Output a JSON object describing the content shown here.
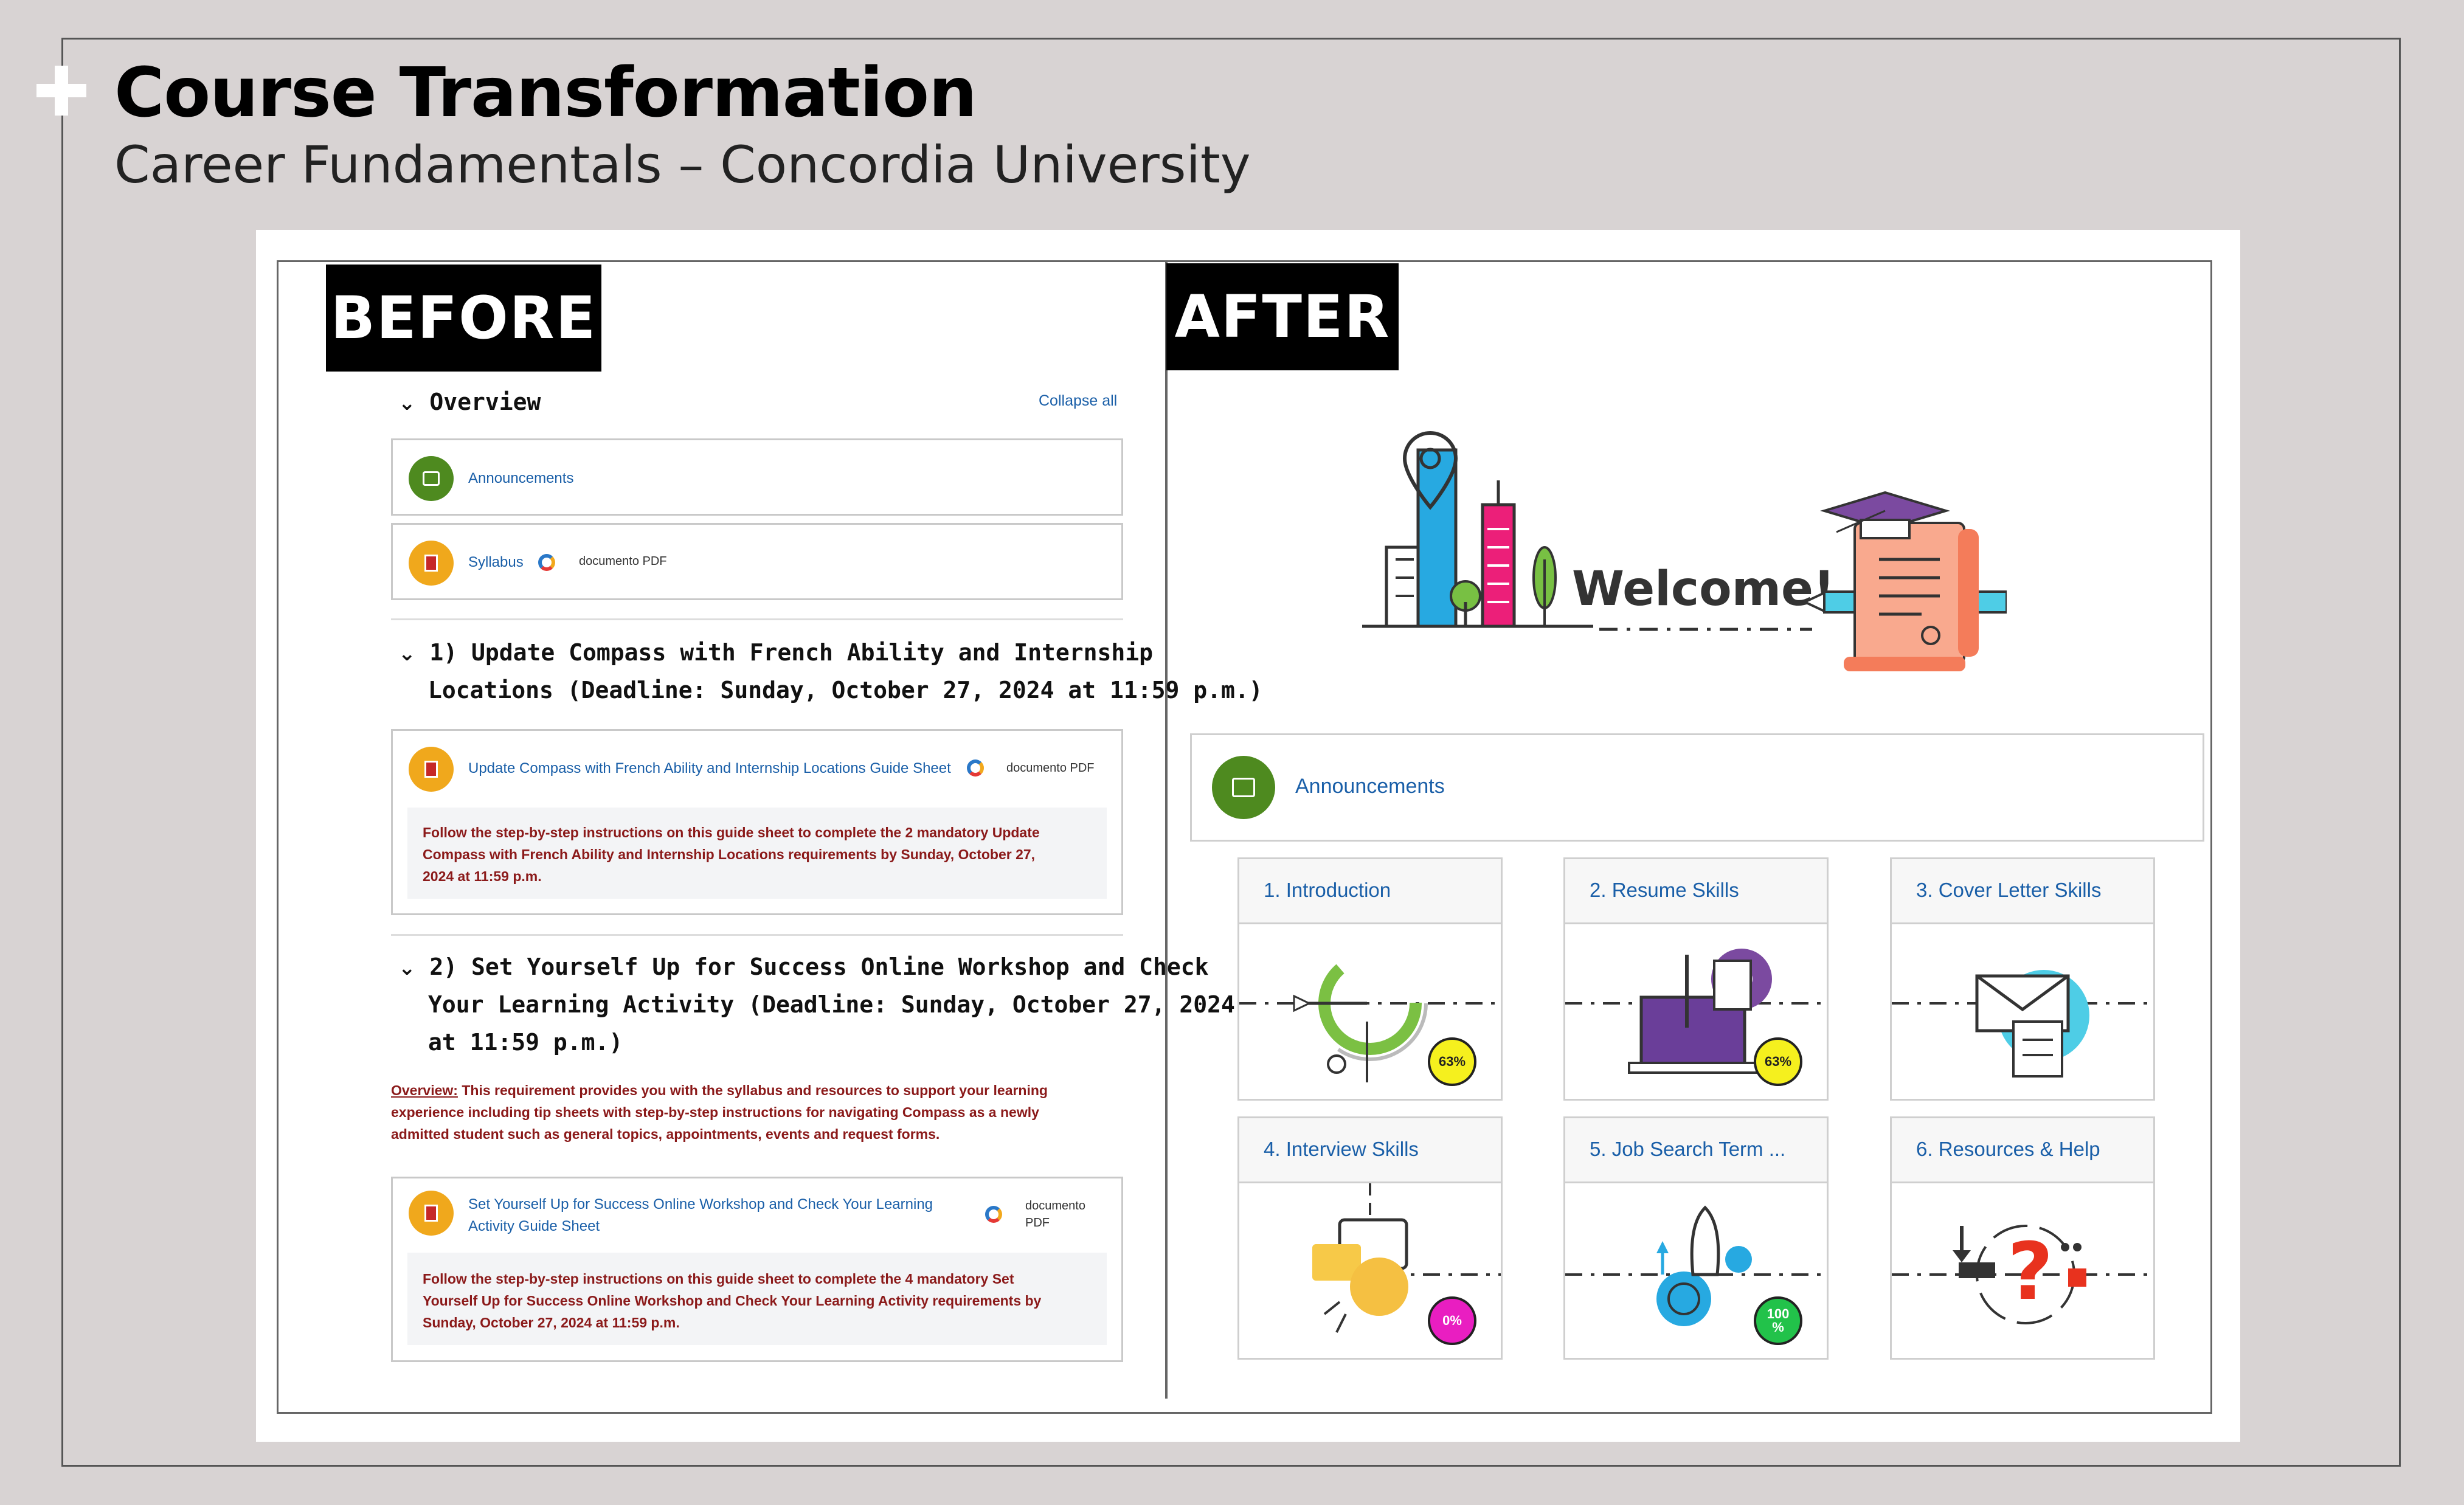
{
  "slide": {
    "title": "Course Transformation",
    "subtitle": "Career Fundamentals – Concordia University"
  },
  "tags": {
    "before": "BEFORE",
    "after": "AFTER"
  },
  "before": {
    "overview_heading": "Overview",
    "collapse_all": "Collapse all",
    "announcements": "Announcements",
    "syllabus": "Syllabus",
    "pdf_label": "documento PDF",
    "section1_line1": "1) Update Compass with French Ability and Internship",
    "section1_line2": "Locations (Deadline: Sunday, October 27, 2024 at 11:59 p.m.)",
    "guide1_link": "Update Compass with French Ability and Internship Locations Guide Sheet",
    "guide1_pdf": "documento PDF",
    "guide1_note_l1": "Follow the step-by-step instructions on this guide sheet to complete the 2 mandatory Update",
    "guide1_note_l2": "Compass with French Ability and Internship Locations requirements by Sunday, October 27,",
    "guide1_note_l3": "2024 at 11:59 p.m.",
    "section2_line1": "2) Set Yourself Up for Success Online Workshop and Check",
    "section2_line2": "Your Learning Activity (Deadline: Sunday, October 27, 2024",
    "section2_line3": "at 11:59 p.m.)",
    "overview_label": "Overview:",
    "overview_l1": " This requirement provides you with the syllabus and resources to support your learning",
    "overview_l2": "experience including tip sheets with step-by-step instructions for navigating Compass as a newly",
    "overview_l3": "admitted student such as general topics, appointments, events and request forms.",
    "guide2_link_l1": "Set Yourself Up for Success Online Workshop and Check Your Learning",
    "guide2_link_l2": "Activity Guide Sheet",
    "guide2_pdf_l1": "documento",
    "guide2_pdf_l2": "PDF",
    "guide2_note_l1": "Follow the step-by-step instructions on this guide sheet to complete the 4 mandatory Set",
    "guide2_note_l2": "Yourself Up for Success Online Workshop and Check Your Learning Activity requirements by",
    "guide2_note_l3": "Sunday, October 27, 2024 at 11:59 p.m."
  },
  "after": {
    "welcome_text": "Welcome!",
    "announcements": "Announcements",
    "tiles": [
      {
        "label": "1. Introduction",
        "badge": "63%"
      },
      {
        "label": "2. Resume Skills",
        "badge": "63%"
      },
      {
        "label": "3. Cover Letter Skills"
      },
      {
        "label": "4. Interview Skills",
        "badge": "0%"
      },
      {
        "label": "5. Job Search Term ...",
        "badge_l1": "100",
        "badge_l2": "%"
      },
      {
        "label": "6. Resources & Help"
      }
    ]
  },
  "colors": {
    "background": "#d8d3d3",
    "link_blue": "#1a5fa8",
    "note_red": "#8b1a1a",
    "announce_green": "#4e8a1f",
    "item_orange": "#f0a81c"
  }
}
